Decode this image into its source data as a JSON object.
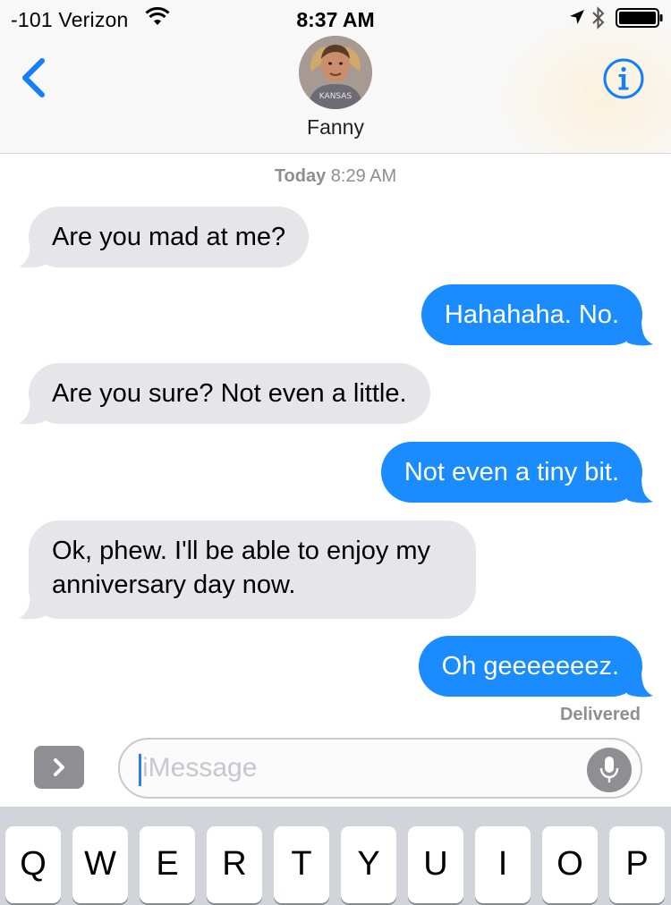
{
  "status_bar": {
    "carrier": "-101 Verizon",
    "time": "8:37 AM",
    "icons": [
      "wifi-icon",
      "location-arrow-icon",
      "bluetooth-icon",
      "battery-icon"
    ]
  },
  "header": {
    "back_icon": "chevron-left-icon",
    "contact_name": "Fanny",
    "info_icon": "info-icon",
    "avatar_text": "KANSAS"
  },
  "conversation": {
    "timestamp_day": "Today",
    "timestamp_time": "8:29 AM",
    "messages": [
      {
        "direction": "incoming",
        "text": "Are you mad at me?"
      },
      {
        "direction": "outgoing",
        "text": "Hahahaha. No."
      },
      {
        "direction": "incoming",
        "text": "Are you sure? Not even a little."
      },
      {
        "direction": "outgoing",
        "text": "Not even a tiny bit."
      },
      {
        "direction": "incoming",
        "text": "Ok, phew. I'll be able to enjoy my anniversary day now."
      },
      {
        "direction": "outgoing",
        "text": "Oh geeeeeeez."
      }
    ],
    "receipt": "Delivered"
  },
  "composer": {
    "apps_icon": "chevron-right-icon",
    "placeholder": "iMessage",
    "mic_icon": "microphone-icon"
  },
  "keyboard": {
    "row1": [
      "Q",
      "W",
      "E",
      "R",
      "T",
      "Y",
      "U",
      "I",
      "O",
      "P"
    ]
  },
  "colors": {
    "outgoing_bubble": "#1a8cff",
    "incoming_bubble": "#e5e5ea",
    "accent": "#157efb",
    "secondary_text": "#8e8e93"
  }
}
